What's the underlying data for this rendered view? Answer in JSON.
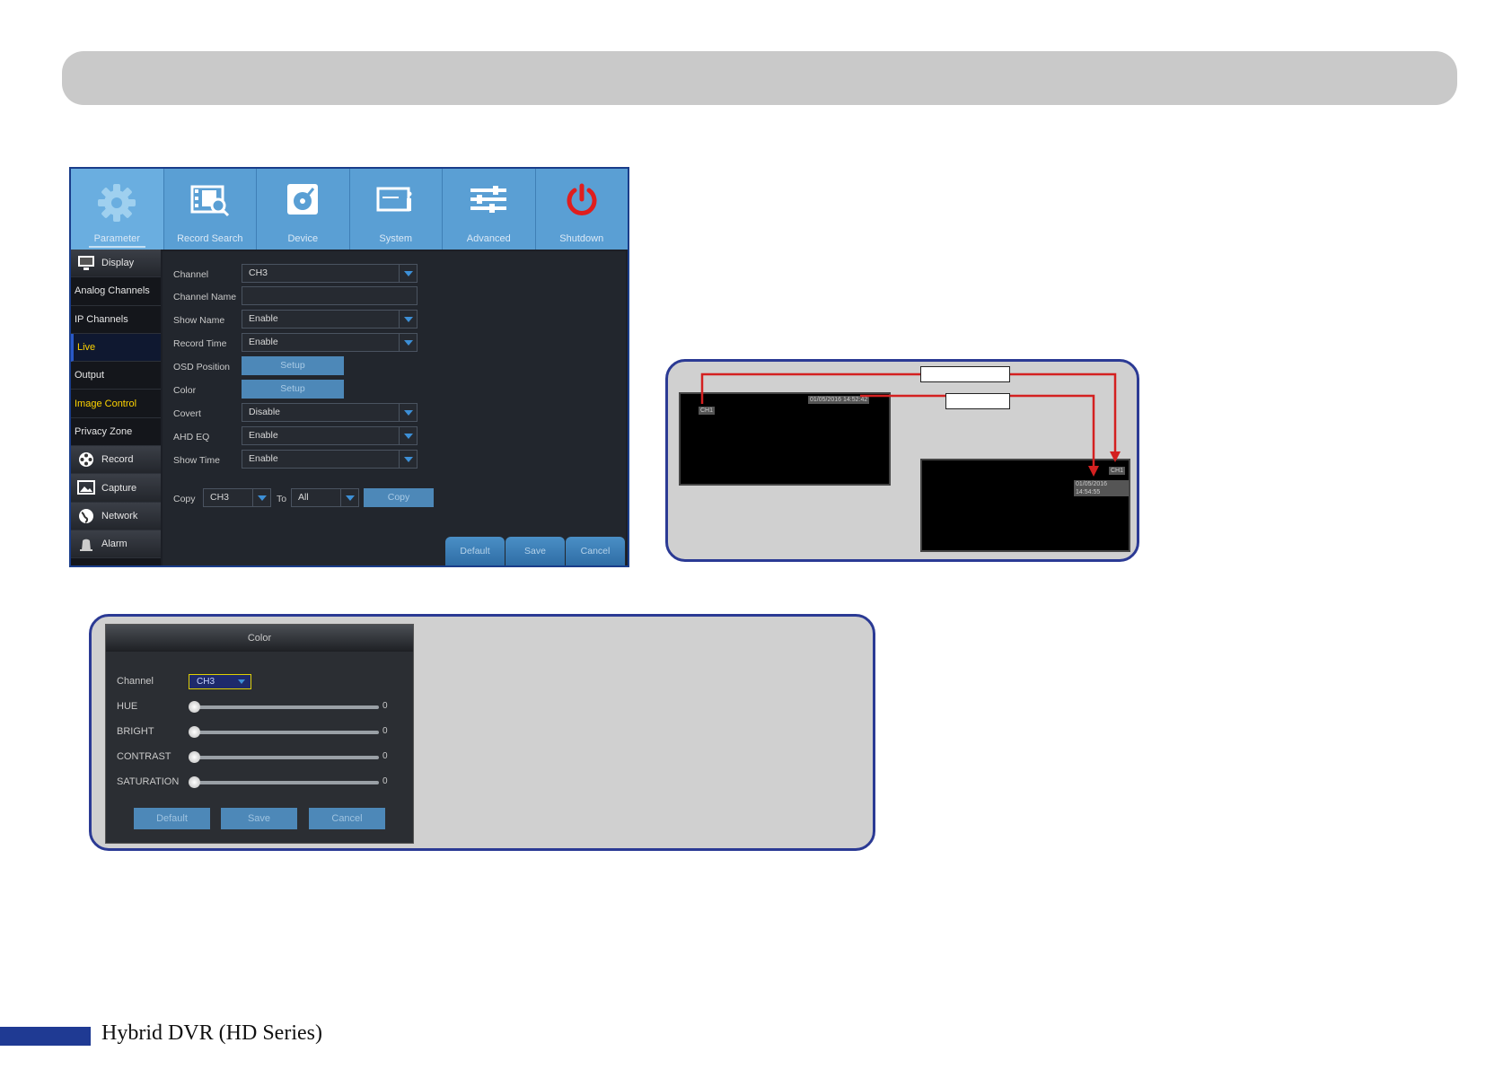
{
  "topbar": {
    "items": [
      {
        "label": "Parameter",
        "icon": "gear-icon"
      },
      {
        "label": "Record Search",
        "icon": "film-search-icon"
      },
      {
        "label": "Device",
        "icon": "disk-icon"
      },
      {
        "label": "System",
        "icon": "system-icon"
      },
      {
        "label": "Advanced",
        "icon": "sliders-icon"
      },
      {
        "label": "Shutdown",
        "icon": "power-icon"
      }
    ]
  },
  "sidebar": {
    "items": [
      {
        "label": "Display"
      },
      {
        "label": "Analog Channels"
      },
      {
        "label": "IP Channels"
      },
      {
        "label": "Live"
      },
      {
        "label": "Output"
      },
      {
        "label": "Image Control"
      },
      {
        "label": "Privacy Zone"
      },
      {
        "label": "Record"
      },
      {
        "label": "Capture"
      },
      {
        "label": "Network"
      },
      {
        "label": "Alarm"
      }
    ]
  },
  "form": {
    "channel_label": "Channel",
    "channel_value": "CH3",
    "channel_name_label": "Channel Name",
    "channel_name_value": "",
    "show_name_label": "Show Name",
    "show_name_value": "Enable",
    "record_time_label": "Record Time",
    "record_time_value": "Enable",
    "osd_position_label": "OSD Position",
    "osd_position_button": "Setup",
    "color_label": "Color",
    "color_button": "Setup",
    "covert_label": "Covert",
    "covert_value": "Disable",
    "ahd_eq_label": "AHD EQ",
    "ahd_eq_value": "Enable",
    "show_time_label": "Show Time",
    "show_time_value": "Enable",
    "copy_label": "Copy",
    "copy_from": "CH3",
    "to_label": "To",
    "copy_to": "All",
    "copy_button": "Copy"
  },
  "footer_buttons": {
    "default": "Default",
    "save": "Save",
    "cancel": "Cancel"
  },
  "osd_demo": {
    "screen1_channel": "CH1",
    "screen1_time": "01/05/2016 14:52:42",
    "screen2_channel": "CH1",
    "screen2_time": "01/05/2016 14:54:55"
  },
  "color_dialog": {
    "title": "Color",
    "channel_label": "Channel",
    "channel_value": "CH3",
    "hue_label": "HUE",
    "hue_value": "0",
    "bright_label": "BRIGHT",
    "bright_value": "0",
    "contrast_label": "CONTRAST",
    "contrast_value": "0",
    "saturation_label": "SATURATION",
    "saturation_value": "0",
    "default_button": "Default",
    "save_button": "Save",
    "cancel_button": "Cancel"
  },
  "page_footer": {
    "title": "Hybrid DVR (HD Series)"
  },
  "colors": {
    "accent": "#5a9fd4",
    "panel_border": "#2b3a94",
    "highlight": "#ffd400",
    "arrow": "#d42020"
  }
}
